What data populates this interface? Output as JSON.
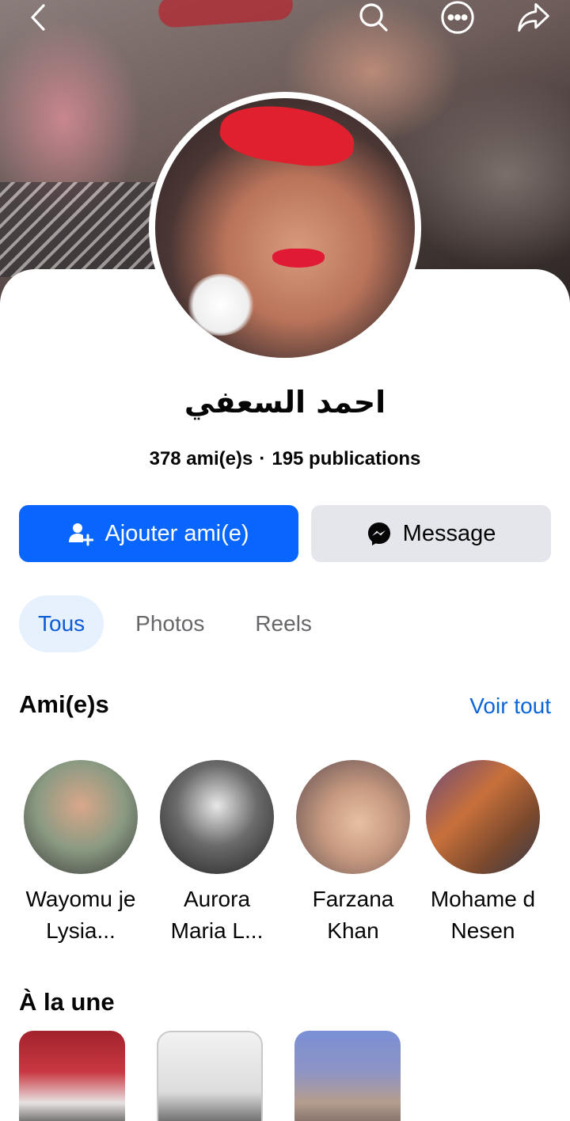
{
  "profile": {
    "name": "احمد السعفي",
    "friends_count": "378 ami(e)s",
    "separator": "·",
    "posts_count": "195 publications"
  },
  "actions": {
    "add_friend_label": "Ajouter ami(e)",
    "message_label": "Message"
  },
  "tabs": [
    {
      "label": "Tous",
      "active": true
    },
    {
      "label": "Photos",
      "active": false
    },
    {
      "label": "Reels",
      "active": false
    }
  ],
  "friends_section": {
    "title": "Ami(e)s",
    "see_all": "Voir tout",
    "friends": [
      {
        "name": "Wayomu je Lysia..."
      },
      {
        "name": "Aurora Maria L..."
      },
      {
        "name": "Farzana Khan"
      },
      {
        "name": "Mohame d Nesen"
      }
    ]
  },
  "featured_section": {
    "title": "À la une"
  },
  "icons": {
    "back": "chevron-left-icon",
    "search": "search-icon",
    "more": "more-dots-icon",
    "share": "share-arrow-icon",
    "add_friend": "person-plus-icon",
    "messenger": "messenger-icon"
  },
  "colors": {
    "primary": "#0866ff",
    "link": "#0a66d8",
    "tab_active_bg": "#e7f0fd",
    "secondary_button": "#e4e6eb"
  }
}
